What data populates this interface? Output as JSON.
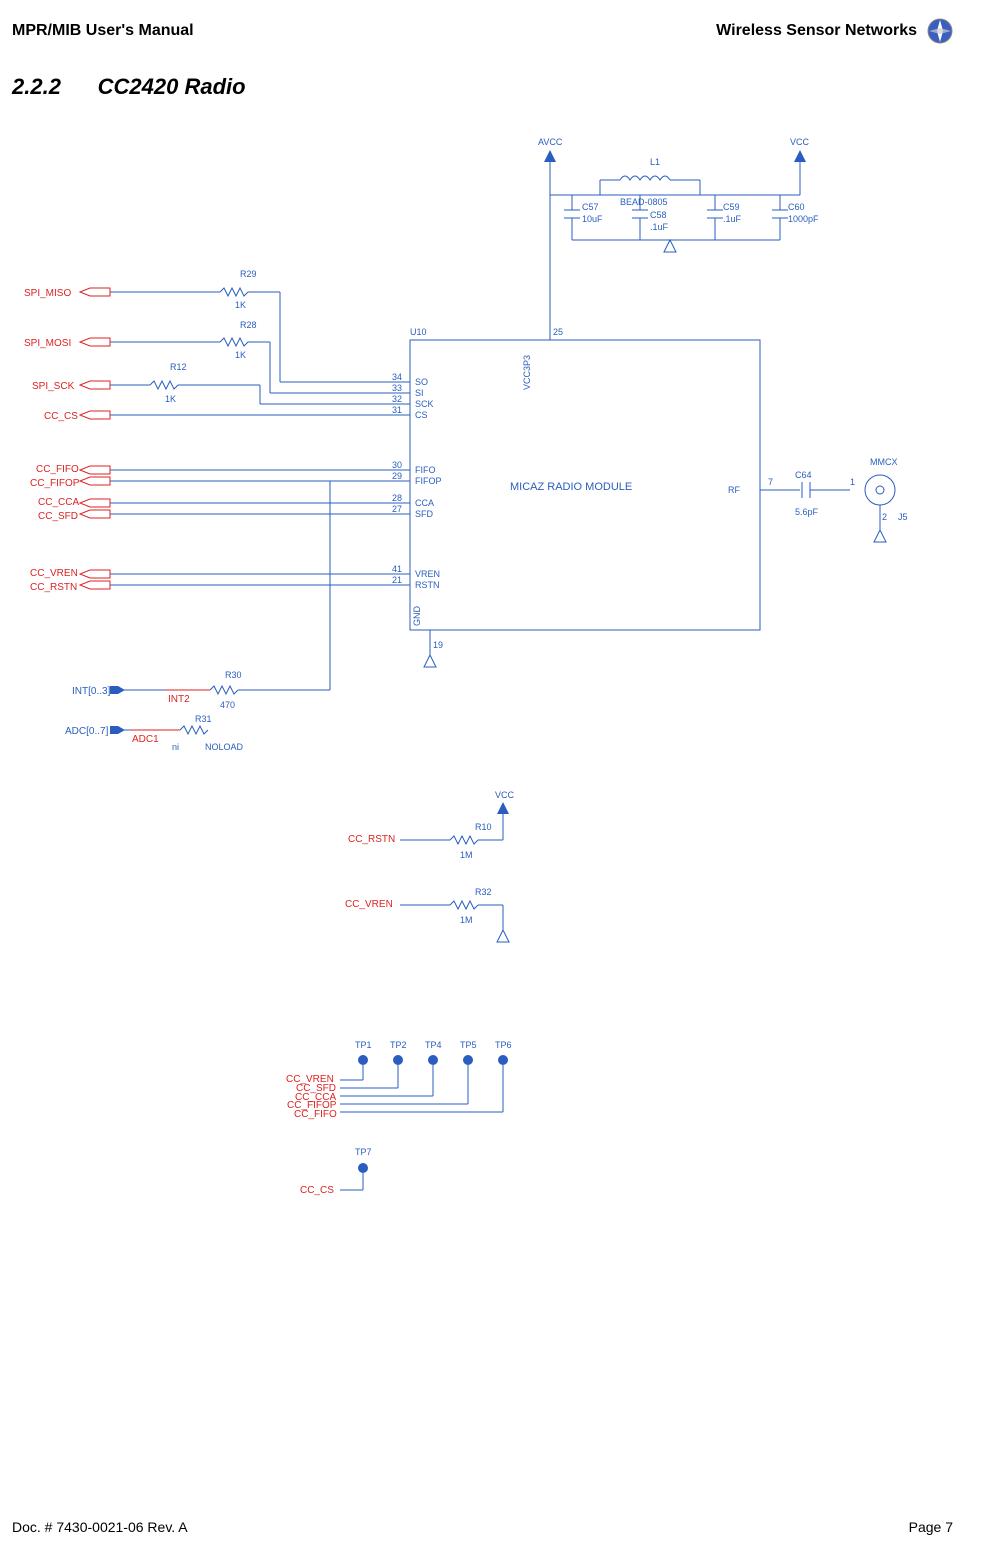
{
  "header": {
    "left": "MPR/MIB User's Manual",
    "right": "Wireless Sensor Networks"
  },
  "section": {
    "number": "2.2.2",
    "title": "CC2420 Radio"
  },
  "schematic": {
    "module_name": "MICAZ RADIO MODULE",
    "module_ref": "U10",
    "pins_left": [
      {
        "num": "34",
        "name": "SO"
      },
      {
        "num": "33",
        "name": "SI"
      },
      {
        "num": "32",
        "name": "SCK"
      },
      {
        "num": "31",
        "name": "CS"
      },
      {
        "num": "30",
        "name": "FIFO"
      },
      {
        "num": "29",
        "name": "FIFOP"
      },
      {
        "num": "28",
        "name": "CCA"
      },
      {
        "num": "27",
        "name": "SFD"
      },
      {
        "num": "41",
        "name": "VREN"
      },
      {
        "num": "21",
        "name": "RSTN"
      }
    ],
    "pin_top": {
      "num": "25",
      "name": "VCC3P3"
    },
    "pin_bottom": {
      "num": "19",
      "name": "GND"
    },
    "pin_right": {
      "num": "7",
      "name": "RF"
    },
    "signals_left": [
      "SPI_MISO",
      "SPI_MOSI",
      "SPI_SCK",
      "CC_CS",
      "CC_FIFO",
      "CC_FIFOP",
      "CC_CCA",
      "CC_SFD",
      "CC_VREN",
      "CC_RSTN"
    ],
    "resistors": [
      {
        "ref": "R29",
        "val": "1K"
      },
      {
        "ref": "R28",
        "val": "1K"
      },
      {
        "ref": "R12",
        "val": "1K"
      },
      {
        "ref": "R30",
        "val": "470"
      },
      {
        "ref": "R31",
        "val": "",
        "note": "NOLOAD",
        "note2": "ni"
      },
      {
        "ref": "R10",
        "val": "1M"
      },
      {
        "ref": "R32",
        "val": "1M"
      }
    ],
    "buses": [
      {
        "name": "INT[0..3]",
        "tap": "INT2"
      },
      {
        "name": "ADC[0..7]",
        "tap": "ADC1"
      }
    ],
    "power_top": {
      "avcc": "AVCC",
      "vcc": "VCC",
      "l1": {
        "ref": "L1",
        "val": "BEAD-0805"
      },
      "caps": [
        {
          "ref": "C57",
          "val": "10uF"
        },
        {
          "ref": "C58",
          "val": ".1uF"
        },
        {
          "ref": "C59",
          "val": ".1uF"
        },
        {
          "ref": "C60",
          "val": "1000pF"
        }
      ]
    },
    "rf_right": {
      "c64": {
        "ref": "C64",
        "val": "5.6pF"
      },
      "conn": "MMCX",
      "conn_ref": "J5"
    },
    "pullups": [
      {
        "sig": "CC_RSTN",
        "vcc": "VCC"
      },
      {
        "sig": "CC_VREN"
      }
    ],
    "testpoints": {
      "row1": [
        "TP1",
        "TP2",
        "TP4",
        "TP5",
        "TP6"
      ],
      "row1_sigs": [
        "CC_VREN",
        "CC_SFD",
        "CC_CCA",
        "CC_FIFOP",
        "CC_FIFO"
      ],
      "row2": [
        "TP7"
      ],
      "row2_sigs": [
        "CC_CS"
      ]
    }
  },
  "footer": {
    "left": "Doc. # 7430-0021-06 Rev. A",
    "right": "Page 7"
  }
}
